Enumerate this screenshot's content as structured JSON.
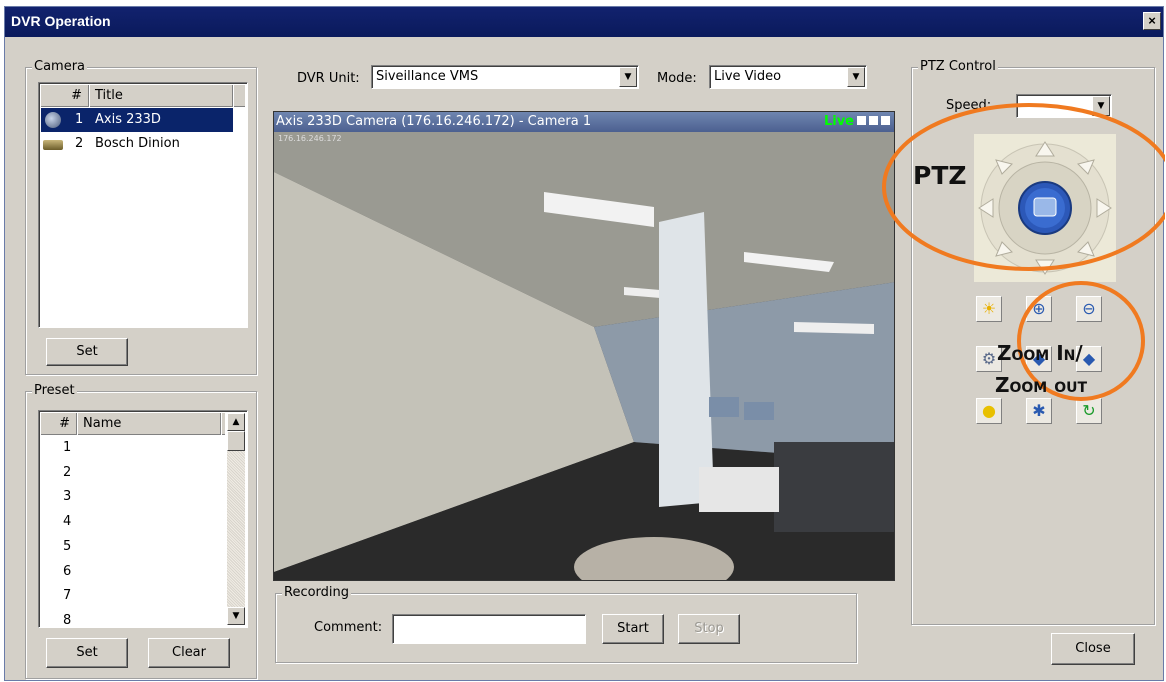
{
  "window": {
    "title": "DVR Operation",
    "close_glyph": "×"
  },
  "camera": {
    "group_label": "Camera",
    "columns": [
      "#",
      "Title"
    ],
    "rows": [
      {
        "num": "1",
        "title": "Axis 233D",
        "icon": "ptz-camera-icon",
        "selected": true
      },
      {
        "num": "2",
        "title": "Bosch Dinion",
        "icon": "fixed-camera-icon",
        "selected": false
      }
    ],
    "set_label": "Set"
  },
  "preset": {
    "group_label": "Preset",
    "columns": [
      "#",
      "Name"
    ],
    "rows": [
      "1",
      "2",
      "3",
      "4",
      "5",
      "6",
      "7",
      "8"
    ],
    "set_label": "Set",
    "clear_label": "Clear"
  },
  "toolbar": {
    "dvr_unit_label": "DVR Unit:",
    "dvr_unit_value": "Siveillance VMS",
    "mode_label": "Mode:",
    "mode_value": "Live Video"
  },
  "video": {
    "title": "Axis 233D Camera (176.16.246.172) - Camera 1",
    "live_label": "Live",
    "overlay_ip": "176.16.246.172"
  },
  "recording": {
    "group_label": "Recording",
    "comment_label": "Comment:",
    "comment_value": "",
    "start_label": "Start",
    "stop_label": "Stop"
  },
  "ptz": {
    "group_label": "PTZ Control",
    "speed_label": "Speed:",
    "speed_value": "",
    "annotation_ptz": "PTZ",
    "annotation_zoom_line1": "Zoom In/",
    "annotation_zoom_line2": "Zoom out",
    "annotation_color": "#f07a20",
    "icons": [
      "brightness-icon",
      "zoom-in-icon",
      "zoom-out-icon",
      "focus-near-icon",
      "focus-far-icon",
      "iris-icon",
      "light-icon",
      "wiper-icon",
      "refresh-icon"
    ]
  },
  "close_label": "Close"
}
